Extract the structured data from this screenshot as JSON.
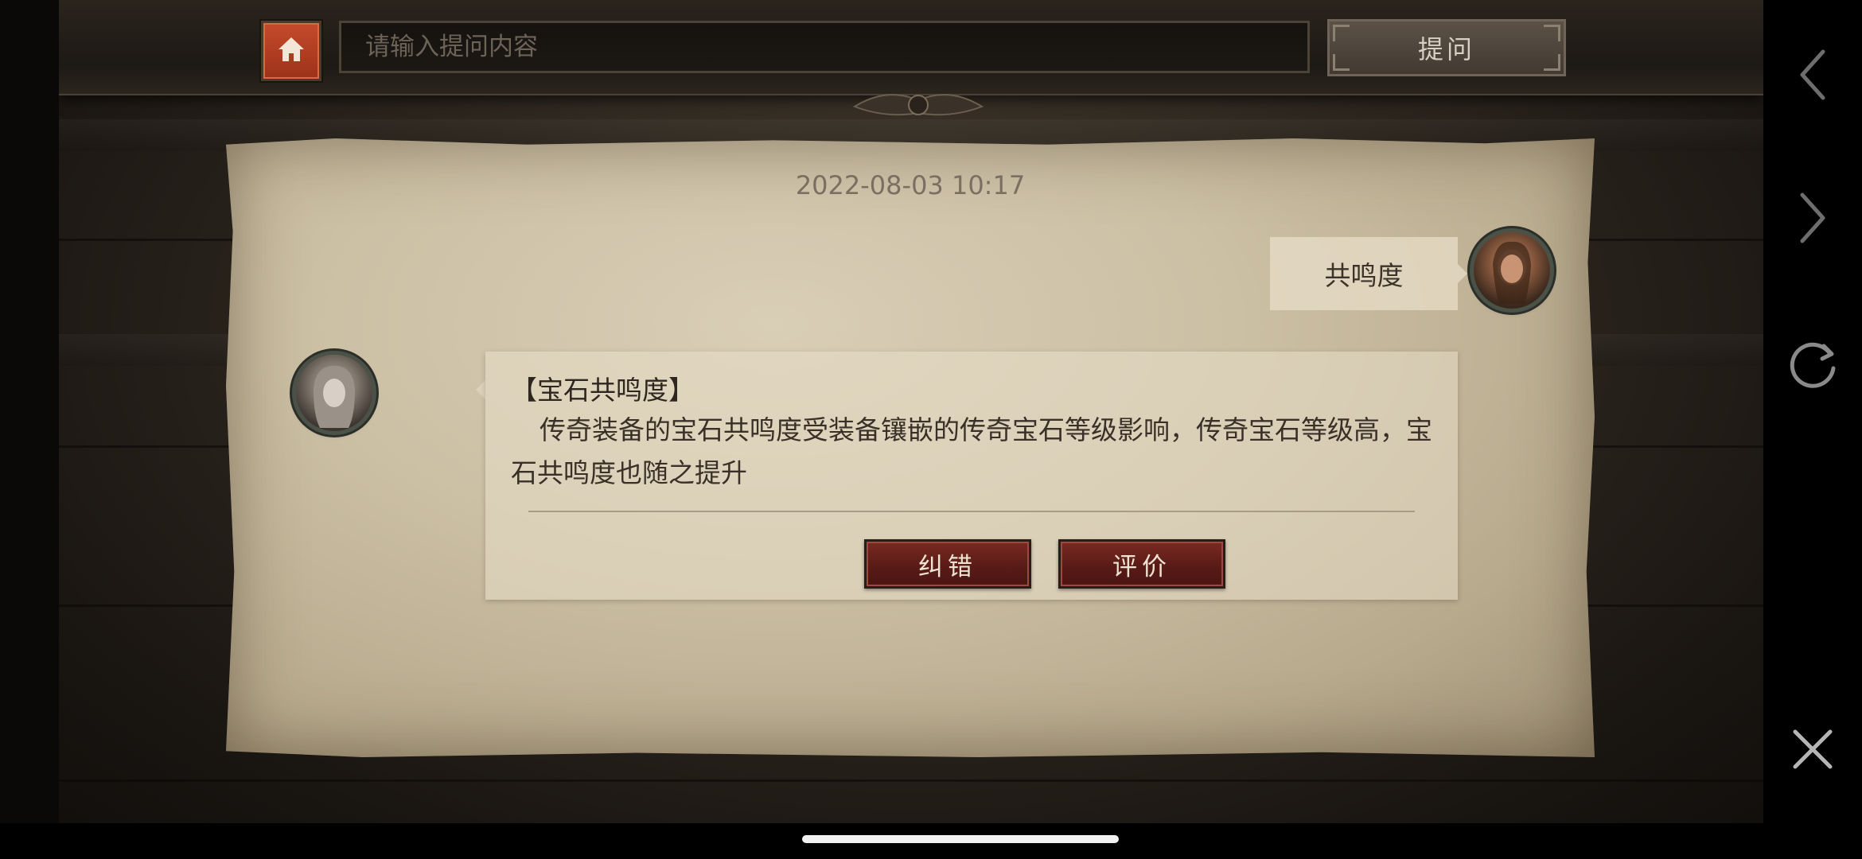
{
  "header": {
    "search_placeholder": "请输入提问内容",
    "ask_label": "提问"
  },
  "conversation": {
    "timestamp": "2022-08-03 10:17",
    "question": "共鸣度",
    "answer": {
      "title": "【宝石共鸣度】",
      "body": "传奇装备的宝石共鸣度受装备镶嵌的传奇宝石等级影响，传奇宝石等级高，宝石共鸣度也随之提升",
      "report_label": "纠错",
      "rate_label": "评价"
    }
  },
  "colors": {
    "home_button": "#b23d22",
    "action_button": "#6a231c",
    "paper": "#cfc3a8"
  },
  "side_nav": {
    "icons": [
      "back-icon",
      "forward-icon",
      "refresh-icon",
      "close-icon"
    ]
  }
}
